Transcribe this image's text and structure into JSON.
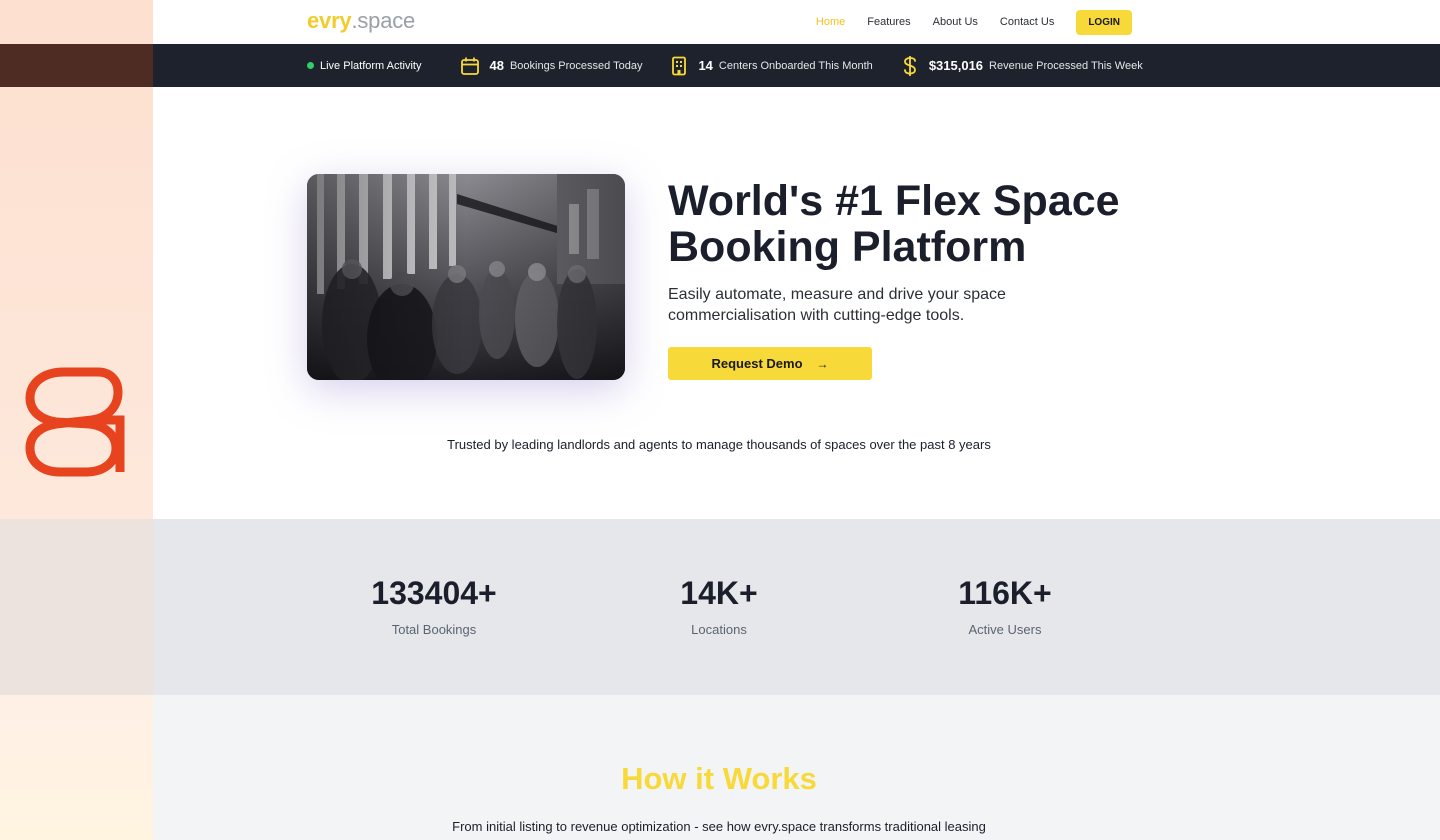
{
  "brand": {
    "part1": "evry",
    "part2": ".space"
  },
  "nav": {
    "links": [
      "Home",
      "Features",
      "About Us",
      "Contact Us"
    ],
    "login_label": "LOGIN"
  },
  "activity": {
    "live_label": "Live Platform Activity",
    "items": [
      {
        "icon": "calendar-icon",
        "value": "48",
        "label": "Bookings Processed Today"
      },
      {
        "icon": "building-icon",
        "value": "14",
        "label": "Centers Onboarded This Month"
      },
      {
        "icon": "dollar-icon",
        "value": "$315,016",
        "label": "Revenue Processed This Week"
      }
    ]
  },
  "hero": {
    "title": "World's #1 Flex Space Booking Platform",
    "subtitle": "Easily automate, measure and drive your space commercialisation with cutting-edge tools.",
    "cta_label": "Request Demo",
    "cta_arrow": "→"
  },
  "trusted_text": "Trusted by leading landlords and agents to manage thousands of spaces over the past 8 years",
  "stats": [
    {
      "value": "133404+",
      "label": "Total Bookings"
    },
    {
      "value": "14K+",
      "label": "Locations"
    },
    {
      "value": "116K+",
      "label": "Active Users"
    }
  ],
  "how_it_works": {
    "title": "How it Works",
    "text": "From initial listing to revenue optimization - see how evry.space transforms traditional leasing"
  },
  "colors": {
    "accent": "#f7d93a",
    "dark_bar": "#1d222c",
    "stats_bg": "#e5e7eb",
    "live_dot": "#2fcf6a",
    "side_logo": "#e8431f"
  }
}
